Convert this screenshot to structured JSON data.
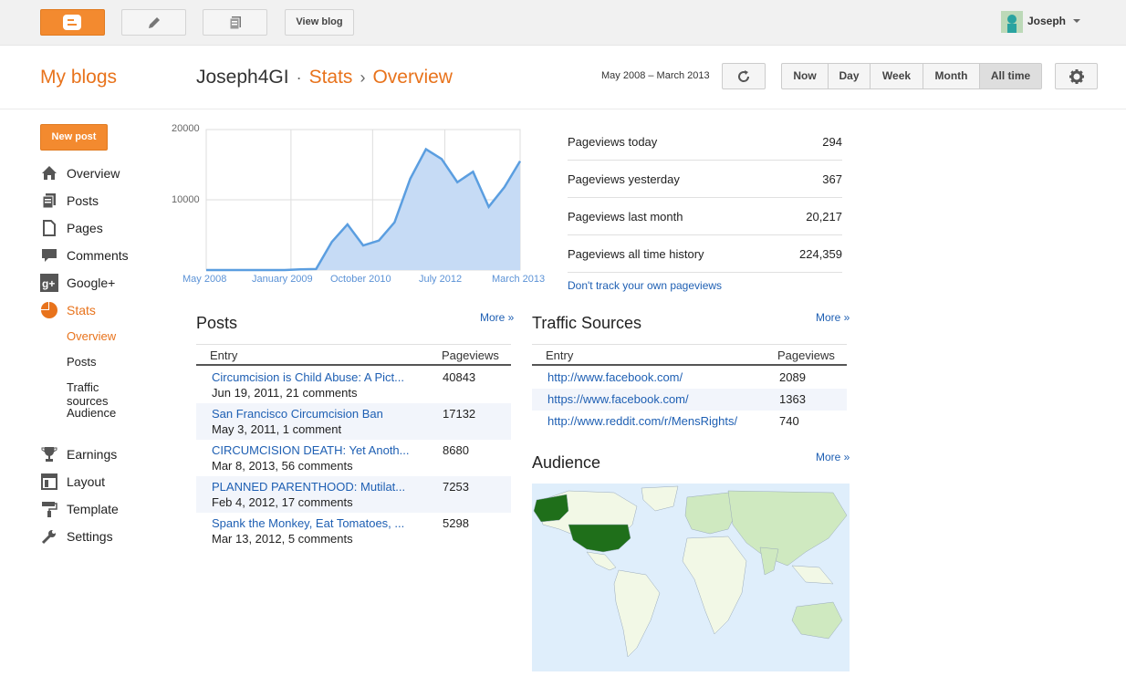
{
  "topbar": {
    "view_blog_label": "View blog",
    "username": "Joseph",
    "icons": [
      "blogger-logo-icon",
      "pencil-icon",
      "posts-list-icon",
      "avatar",
      "chevron-down-icon"
    ]
  },
  "header": {
    "my_blogs": "My blogs",
    "blog_name": "Joseph4GI",
    "bullet": "·",
    "crumb_stats": "Stats",
    "crumb_sep": "›",
    "crumb_overview": "Overview",
    "date_range": "May 2008 – March 2013",
    "ranges": [
      "Now",
      "Day",
      "Week",
      "Month",
      "All time"
    ],
    "selected_range": "All time"
  },
  "sidebar": {
    "new_post": "New post",
    "items": [
      {
        "label": "Overview"
      },
      {
        "label": "Posts"
      },
      {
        "label": "Pages"
      },
      {
        "label": "Comments"
      },
      {
        "label": "Google+"
      },
      {
        "label": "Stats"
      },
      {
        "label": "Earnings"
      },
      {
        "label": "Layout"
      },
      {
        "label": "Template"
      },
      {
        "label": "Settings"
      }
    ],
    "stats_sub": [
      {
        "label": "Overview"
      },
      {
        "label": "Posts"
      },
      {
        "label": "Traffic sources"
      },
      {
        "label": "Audience"
      }
    ],
    "colors": {
      "accent": "#e8731c"
    }
  },
  "chart_data": {
    "type": "area",
    "x": [
      "2008-05",
      "2008-08",
      "2008-11",
      "2009-02",
      "2009-05",
      "2009-08",
      "2009-11",
      "2010-02",
      "2010-05",
      "2010-08",
      "2010-11",
      "2011-02",
      "2011-05",
      "2011-08",
      "2011-11",
      "2012-02",
      "2012-05",
      "2012-08",
      "2012-11",
      "2013-02",
      "2013-03"
    ],
    "values": [
      0,
      0,
      0,
      0,
      0,
      0,
      100,
      150,
      4000,
      6500,
      3500,
      4200,
      6800,
      13000,
      17200,
      15800,
      12500,
      14000,
      9000,
      11800,
      15500
    ],
    "ylim": [
      0,
      20000
    ],
    "yticks": [
      "20000",
      "10000"
    ],
    "xtick_labels": [
      "May 2008",
      "January 2009",
      "October 2010",
      "July 2012",
      "March 2013"
    ],
    "grid": true,
    "colors": {
      "line": "#5b9ee0",
      "fill": "#c6dbf5"
    }
  },
  "kpis": [
    {
      "label": "Pageviews today",
      "value": "294"
    },
    {
      "label": "Pageviews yesterday",
      "value": "367"
    },
    {
      "label": "Pageviews last month",
      "value": "20,217"
    },
    {
      "label": "Pageviews all time history",
      "value": "224,359"
    }
  ],
  "track_link": "Don't track your own pageviews",
  "posts": {
    "title": "Posts",
    "more": "More »",
    "col_entry": "Entry",
    "col_pageviews": "Pageviews",
    "rows": [
      {
        "title": "Circumcision is Child Abuse: A Pict...",
        "sub": "Jun 19, 2011, 21 comments",
        "views": "40843"
      },
      {
        "title": "San Francisco Circumcision Ban",
        "sub": "May 3, 2011, 1 comment",
        "views": "17132"
      },
      {
        "title": "CIRCUMCISION DEATH: Yet Anoth...",
        "sub": "Mar 8, 2013, 56 comments",
        "views": "8680"
      },
      {
        "title": "PLANNED PARENTHOOD: Mutilat...",
        "sub": "Feb 4, 2012, 17 comments",
        "views": "7253"
      },
      {
        "title": "Spank the Monkey, Eat Tomatoes, ...",
        "sub": "Mar 13, 2012, 5 comments",
        "views": "5298"
      }
    ]
  },
  "traffic": {
    "title": "Traffic Sources",
    "more": "More »",
    "col_entry": "Entry",
    "col_pageviews": "Pageviews",
    "rows": [
      {
        "url": "http://www.facebook.com/",
        "views": "2089"
      },
      {
        "url": "https://www.facebook.com/",
        "views": "1363"
      },
      {
        "url": "http://www.reddit.com/r/MensRights/",
        "views": "740"
      }
    ]
  },
  "audience": {
    "title": "Audience",
    "more": "More »",
    "colors": {
      "ocean": "#dfeefb",
      "top_country": "#1f6f1a",
      "low": "#f2f8e6",
      "mid": "#cfe9c0"
    }
  }
}
